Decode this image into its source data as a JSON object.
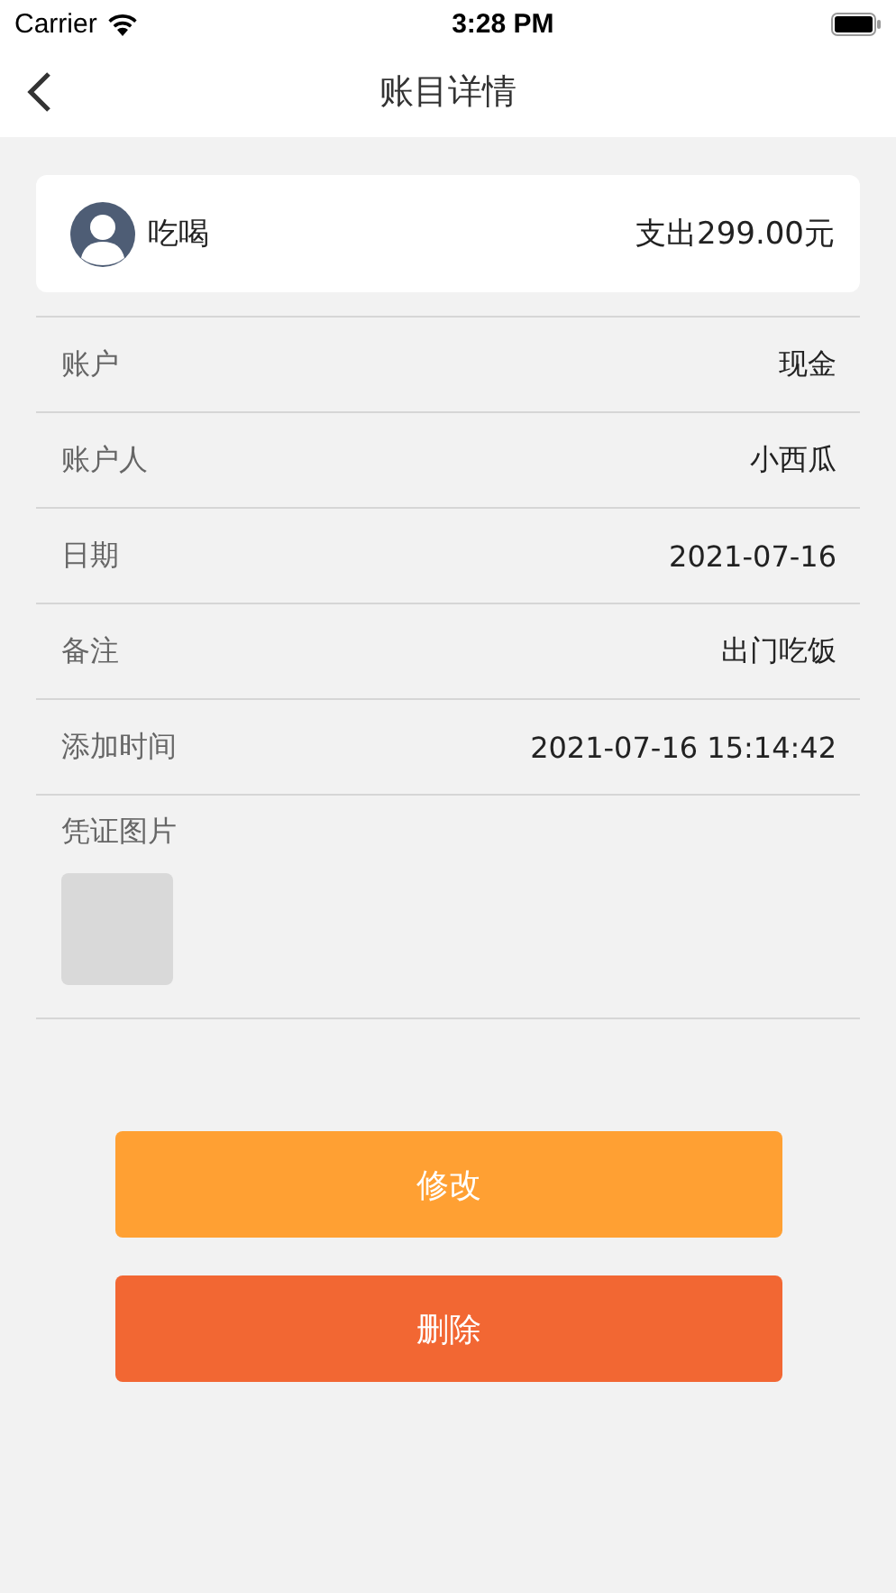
{
  "status_bar": {
    "carrier": "Carrier",
    "time": "3:28 PM"
  },
  "nav": {
    "title": "账目详情"
  },
  "summary": {
    "category": "吃喝",
    "amount": "支出299.00元"
  },
  "fields": [
    {
      "label": "账户",
      "value": "现金"
    },
    {
      "label": "账户人",
      "value": "小西瓜"
    },
    {
      "label": "日期",
      "value": "2021-07-16"
    },
    {
      "label": "备注",
      "value": "出门吃饭"
    },
    {
      "label": "添加时间",
      "value": "2021-07-16 15:14:42"
    }
  ],
  "voucher": {
    "label": "凭证图片"
  },
  "buttons": [
    {
      "label": "修改",
      "kind": "edit"
    },
    {
      "label": "删除",
      "kind": "delete"
    }
  ]
}
